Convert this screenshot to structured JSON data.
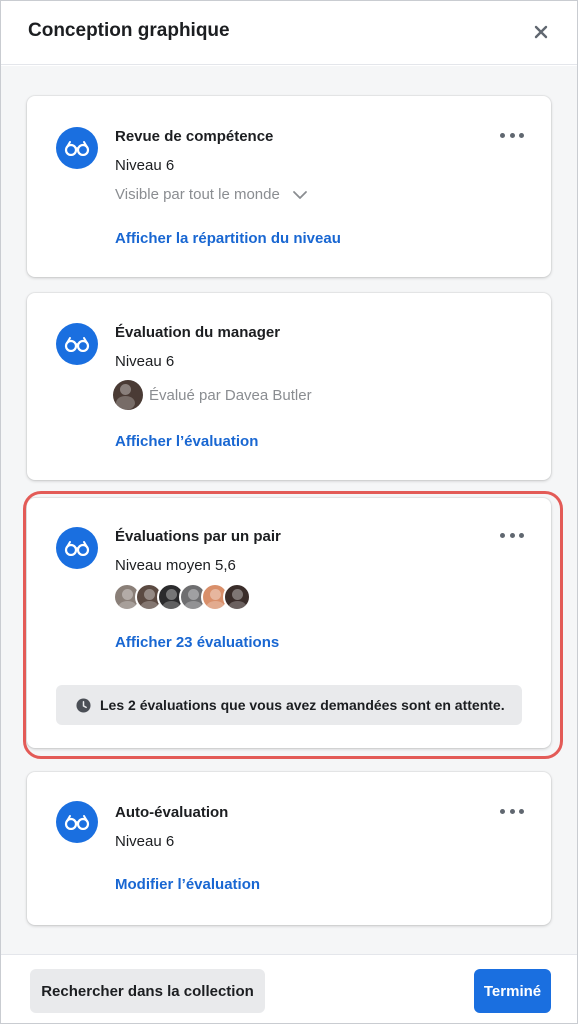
{
  "header": {
    "title": "Conception graphique"
  },
  "cards": [
    {
      "title": "Revue de compétence",
      "level": "Niveau 6",
      "visibility": "Visible par tout le monde",
      "link": "Afficher la répartition du niveau"
    },
    {
      "title": "Évaluation du manager",
      "level": "Niveau 6",
      "evaluator": "Évalué par Davea Butler",
      "link": "Afficher l’évaluation"
    },
    {
      "title": "Évaluations par un pair",
      "level": "Niveau moyen 5,6",
      "link": "Afficher 23 évaluations",
      "notice": "Les 2 évaluations que vous avez demandées sont en attente."
    },
    {
      "title": "Auto-évaluation",
      "level": "Niveau 6",
      "link": "Modifier l’évaluation"
    }
  ],
  "footer": {
    "search_button": "Rechercher dans la collection",
    "done_button": "Terminé"
  },
  "colors": {
    "accent": "#1a6fe0",
    "link": "#1967d2",
    "highlight": "#e35b57"
  },
  "icons": {
    "card_icon": "glasses-icon",
    "close": "close-icon",
    "more": "more-options-icon",
    "chevron": "chevron-down-icon",
    "clock": "clock-icon"
  }
}
